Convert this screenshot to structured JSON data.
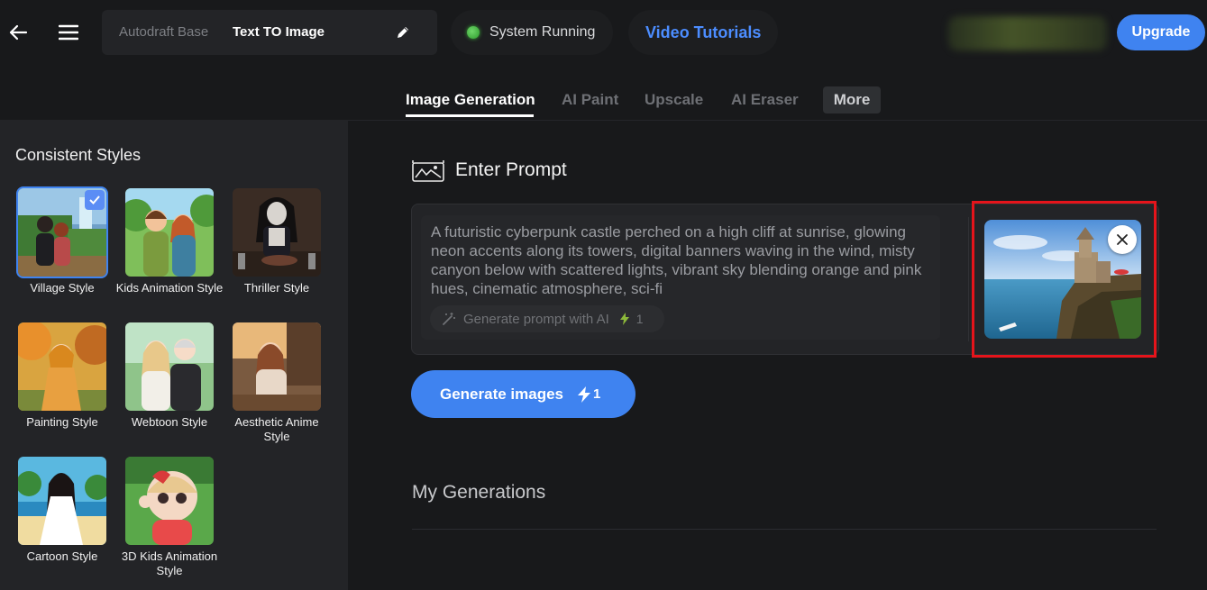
{
  "header": {
    "project_base": "Autodraft Base",
    "project_name": "Text TO Image",
    "status_text": "System Running",
    "tutorials_label": "Video Tutorials",
    "upgrade_label": "Upgrade"
  },
  "tabs": [
    {
      "label": "Image Generation",
      "active": true
    },
    {
      "label": "AI Paint"
    },
    {
      "label": "Upscale"
    },
    {
      "label": "AI Eraser"
    },
    {
      "label": "More"
    }
  ],
  "sidebar": {
    "title": "Consistent Styles",
    "styles": [
      {
        "label": "Village Style",
        "selected": true
      },
      {
        "label": "Kids Animation Style"
      },
      {
        "label": "Thriller Style"
      },
      {
        "label": "Painting Style"
      },
      {
        "label": "Webtoon Style"
      },
      {
        "label": "Aesthetic Anime Style"
      },
      {
        "label": "Cartoon Style"
      },
      {
        "label": "3D Kids Animation Style"
      }
    ]
  },
  "main": {
    "prompt_heading": "Enter Prompt",
    "prompt_text": "A futuristic cyberpunk castle perched on a high cliff at sunrise, glowing neon accents along its towers, digital banners waving in the wind, misty canyon below with scattered lights, vibrant sky blending orange and pink hues, cinematic atmosphere, sci-fi",
    "generate_prompt_label": "Generate prompt with AI",
    "generate_prompt_count": "1",
    "generate_label": "Generate images",
    "generate_count": "1",
    "my_generations": "My Generations"
  },
  "colors": {
    "accent": "#3f83f0",
    "tutorials": "#4c8dff",
    "status_dot": "#3fb13c",
    "highlight_frame": "#e5141b"
  }
}
